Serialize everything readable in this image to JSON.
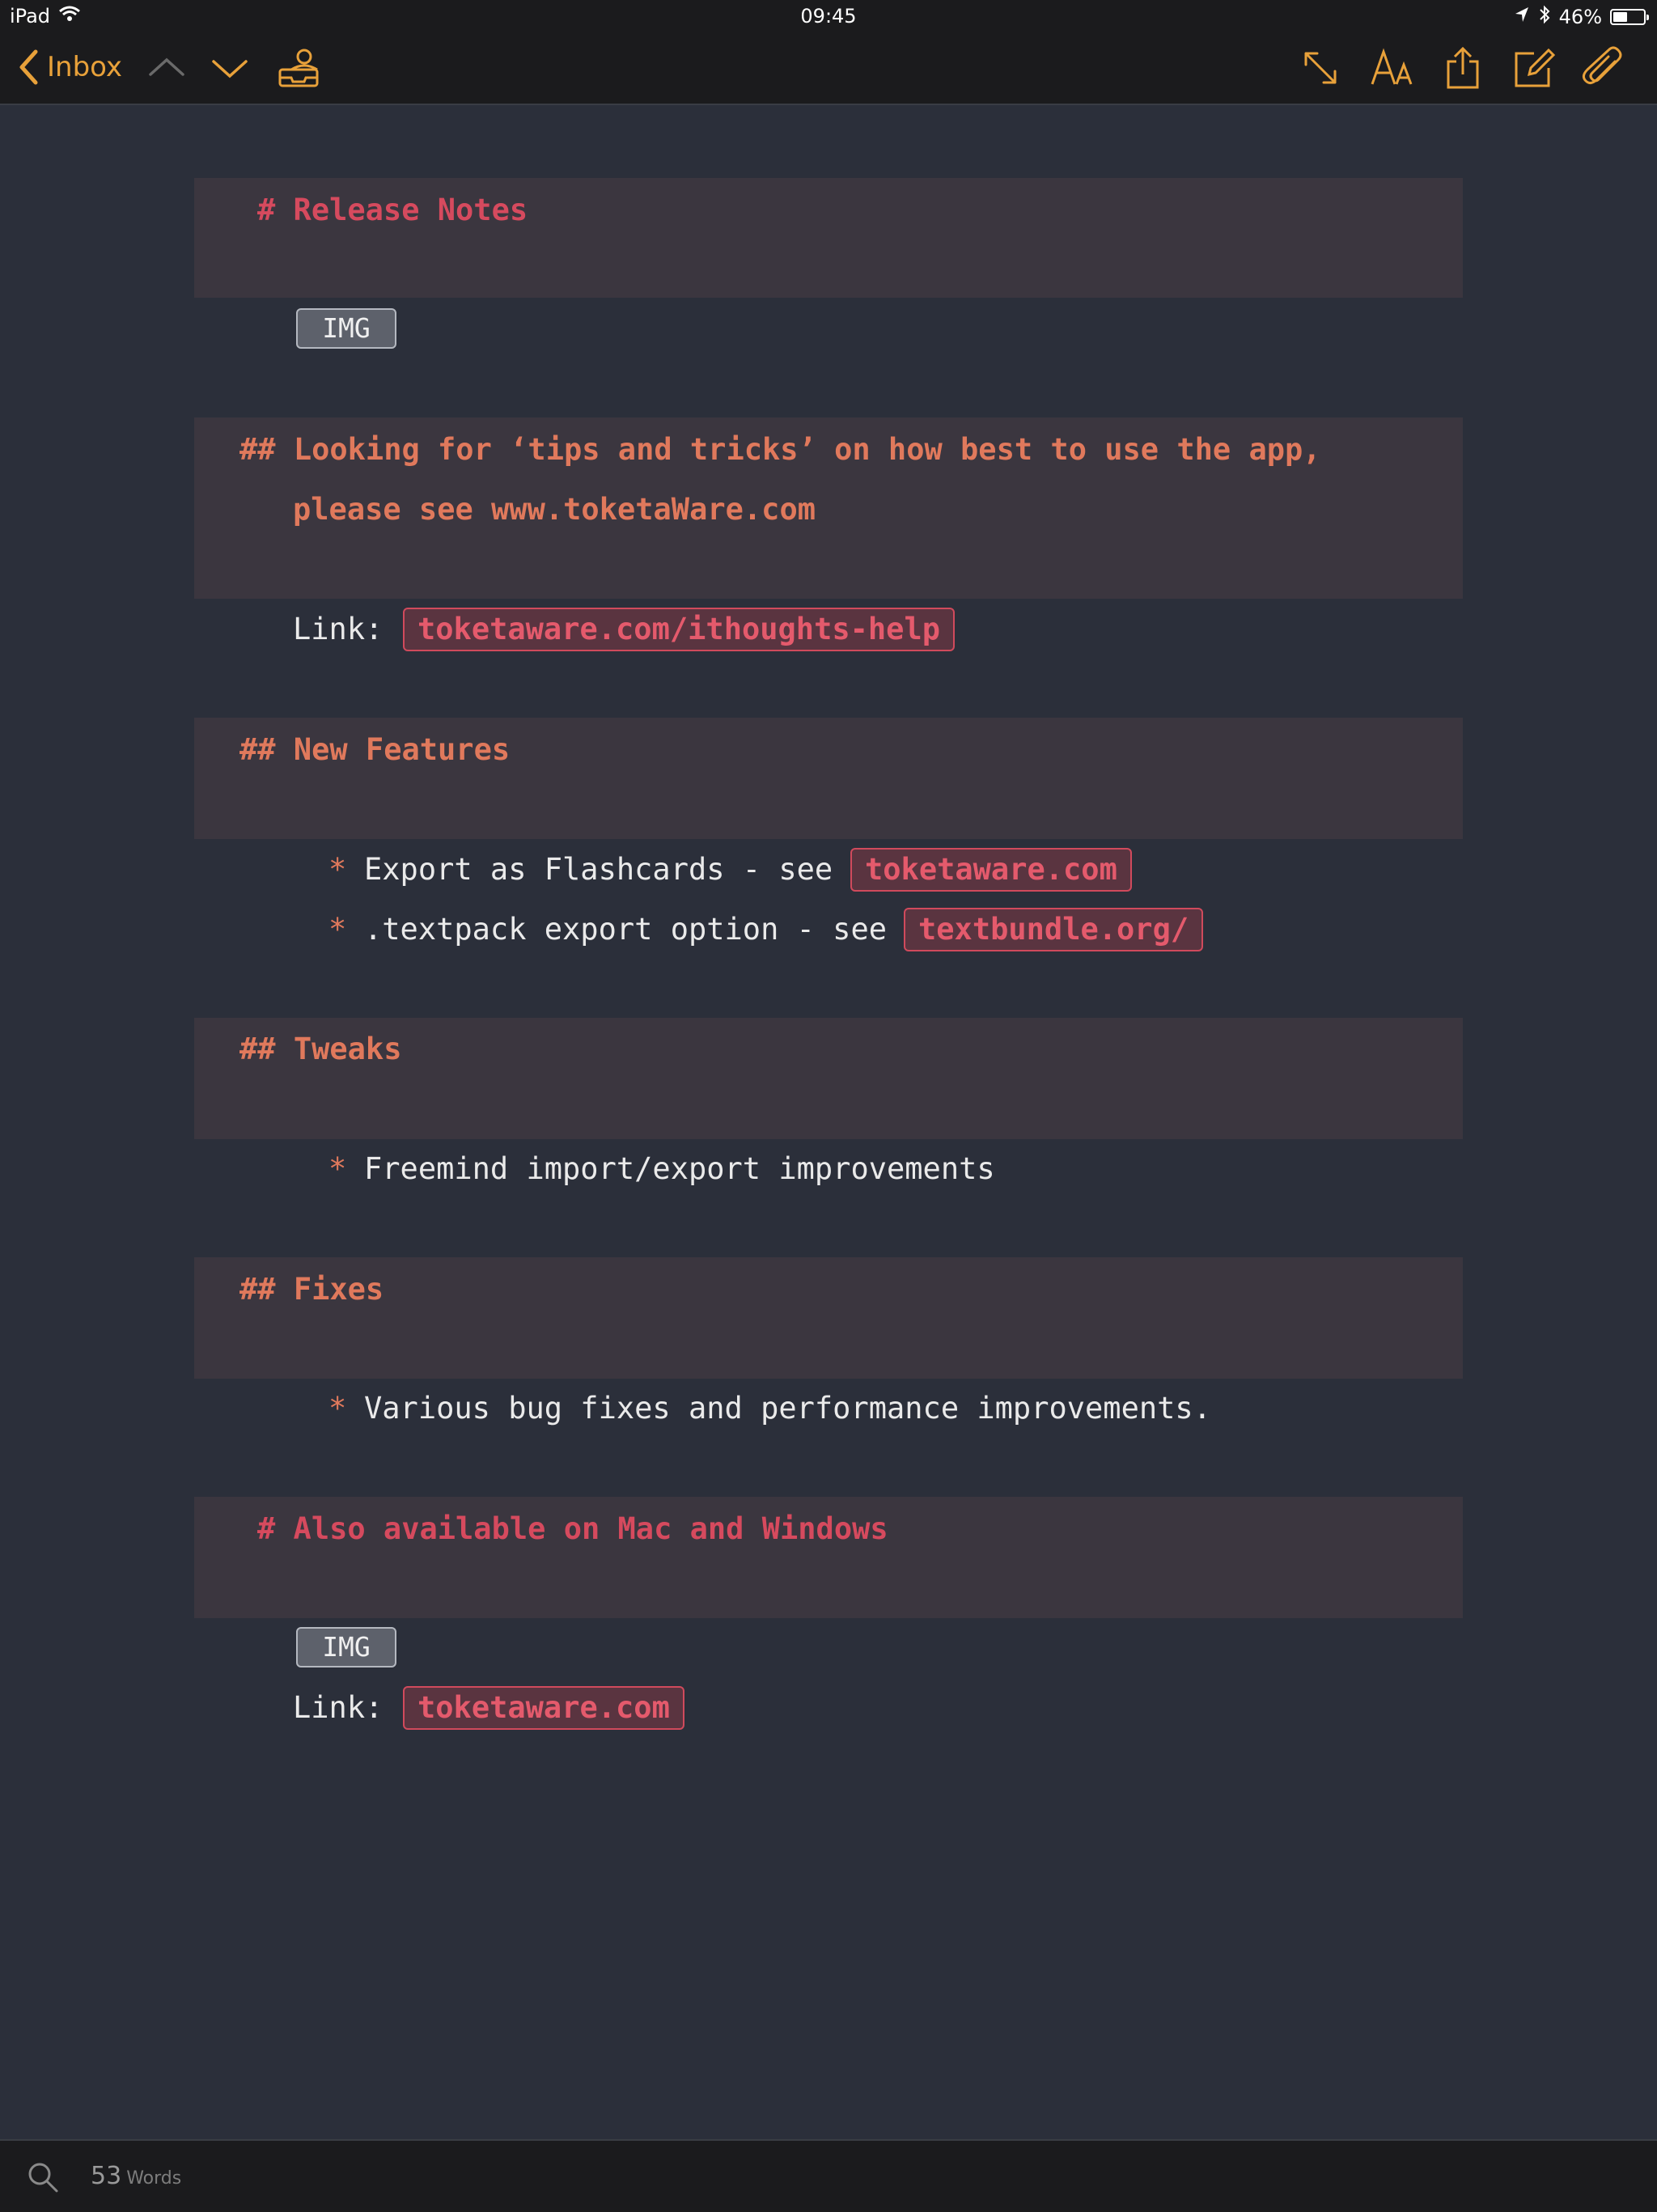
{
  "status_bar": {
    "device": "iPad",
    "time": "09:45",
    "battery_text": "46%",
    "battery_level": 0.46
  },
  "nav": {
    "back_label": "Inbox",
    "accent_color": "#e8a13a",
    "icons": [
      "chevron-up-icon",
      "chevron-down-icon",
      "inbox-tray-icon",
      "expand-icon",
      "font-size-icon",
      "share-icon",
      "compose-icon",
      "paperclip-icon"
    ]
  },
  "document": {
    "h1_release": "# Release Notes",
    "img1": "IMG",
    "h2_looking_line1": "## Looking for ‘tips and tricks’ on how best to use the app,",
    "h2_looking_line2": "please see www.toketaWare.com",
    "link1_label": "Link:",
    "link1_url": "toketaware.com/ithoughts-help",
    "h2_new_features": "## New Features",
    "bullet_star": "*",
    "nf_item1_text": "Export as Flashcards - see",
    "nf_item1_link": "toketaware.com",
    "nf_item2_text": ".textpack export option - see",
    "nf_item2_link": "textbundle.org/",
    "h2_tweaks": "## Tweaks",
    "tweak_item1": "Freemind import/export improvements",
    "h2_fixes": "## Fixes",
    "fix_item1": "Various bug fixes and performance improvements.",
    "h1_also": "# Also available on Mac and Windows",
    "img2": "IMG",
    "link2_label": "Link:",
    "link2_url": "toketaware.com"
  },
  "bottom": {
    "word_count": "53",
    "word_unit": "Words"
  }
}
